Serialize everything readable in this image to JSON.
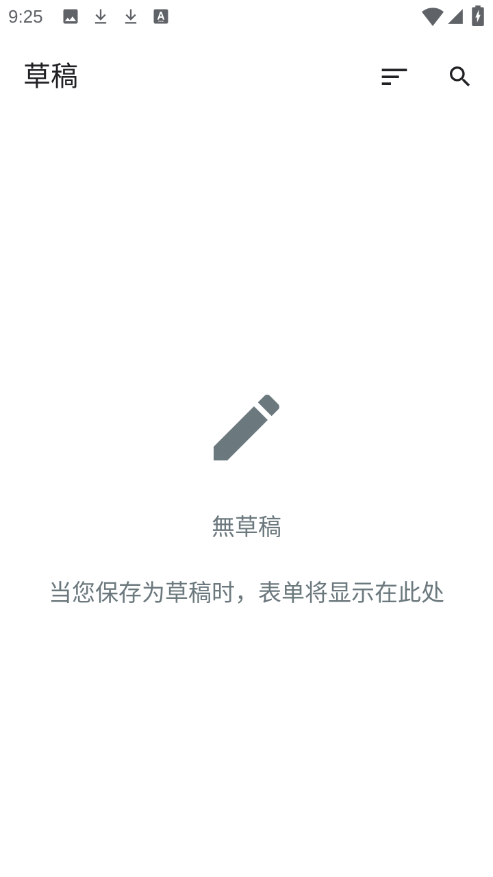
{
  "status_bar": {
    "time": "9:25",
    "left_icons": [
      "image-icon",
      "download-icon",
      "download-icon",
      "font-app-icon"
    ],
    "right_icons": [
      "wifi-icon",
      "cellular-signal-icon",
      "battery-charging-icon"
    ]
  },
  "app_bar": {
    "title": "草稿",
    "actions": [
      "sort-icon",
      "search-icon"
    ]
  },
  "empty_state": {
    "icon": "pencil-icon",
    "title": "無草稿",
    "message": "当您保存为草稿时，表单将显示在此处"
  },
  "colors": {
    "status_icon": "#5f6368",
    "title_text": "#202124",
    "empty_state": "#6b787d",
    "background": "#ffffff"
  }
}
